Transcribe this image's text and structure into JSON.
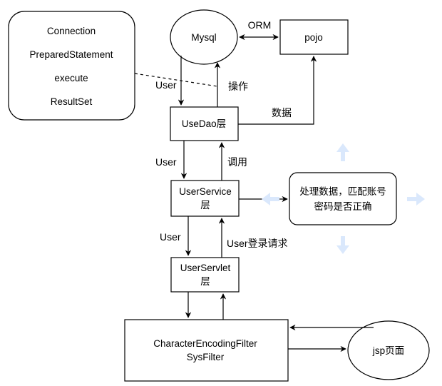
{
  "nodes": {
    "jdbc_box": {
      "lines": [
        "Connection",
        "PreparedStatement",
        "execute",
        "ResultSet"
      ]
    },
    "mysql": {
      "label": "Mysql"
    },
    "pojo": {
      "label": "pojo"
    },
    "usedao": {
      "label": "UseDao层"
    },
    "userservice": {
      "line1": "UserService",
      "line2": "层"
    },
    "userservlet": {
      "line1": "UserServlet",
      "line2": "层"
    },
    "filter": {
      "line1": "CharacterEncodingFilter",
      "line2": "SysFilter"
    },
    "jsp": {
      "label": "jsp页面"
    },
    "process": {
      "line1": "处理数据，匹配账号",
      "line2": "密码是否正确"
    }
  },
  "edges": {
    "orm": "ORM",
    "operate": "操作",
    "user_dao_to_mysql": "User",
    "data": "数据",
    "user_service_to_dao": "User",
    "call": "调用",
    "user_servlet_to_service": "User",
    "login_request": "User登录请求"
  },
  "colors": {
    "stroke": "#000000",
    "highlight_arrow": "#dae8fc"
  }
}
